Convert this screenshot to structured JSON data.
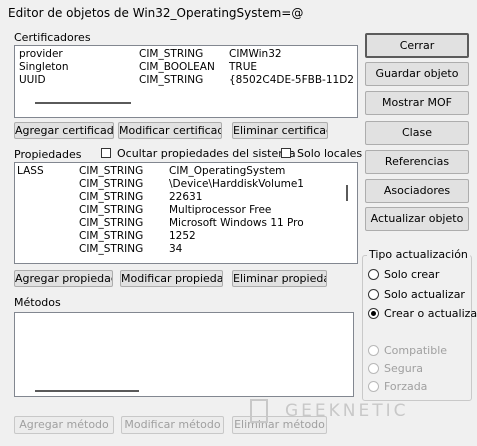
{
  "window": {
    "title": "Editor de objetos de Win32_OperatingSystem=@"
  },
  "qualifiers": {
    "label": "Certificadores",
    "rows": [
      {
        "name": "provider",
        "type": "CIM_STRING",
        "value": "CIMWin32"
      },
      {
        "name": "Singleton",
        "type": "CIM_BOOLEAN",
        "value": "TRUE"
      },
      {
        "name": "UUID",
        "type": "CIM_STRING",
        "value": "{8502C4DE-5FBB-11D2"
      }
    ],
    "buttons": {
      "add": "Agregar certificador",
      "edit": "Modificar certificador",
      "delete": "Eliminar certificador"
    }
  },
  "properties": {
    "label": "Propiedades",
    "hide_system_label": "Ocultar propiedades del sistema",
    "local_only_label": "Solo locales",
    "rows": [
      {
        "name": "LASS",
        "type": "CIM_STRING",
        "value": "CIM_OperatingSystem"
      },
      {
        "name": "",
        "type": "CIM_STRING",
        "value": "\\Device\\HarddiskVolume1"
      },
      {
        "name": "",
        "type": "CIM_STRING",
        "value": "22631"
      },
      {
        "name": "",
        "type": "CIM_STRING",
        "value": "Multiprocessor Free"
      },
      {
        "name": "",
        "type": "CIM_STRING",
        "value": "Microsoft Windows 11 Pro"
      },
      {
        "name": "",
        "type": "CIM_STRING",
        "value": "1252"
      },
      {
        "name": "",
        "type": "CIM_STRING",
        "value": "34"
      }
    ],
    "buttons": {
      "add": "Agregar propiedad",
      "edit": "Modificar propiedad",
      "delete": "Eliminar propiedad"
    }
  },
  "methods": {
    "label": "Métodos",
    "buttons": {
      "add": "Agregar método",
      "edit": "Modificar método",
      "delete": "Eliminar método"
    }
  },
  "side_buttons": {
    "close": "Cerrar",
    "save": "Guardar objeto",
    "show_mof": "Mostrar MOF",
    "class": "Clase",
    "references": "Referencias",
    "associators": "Asociadores",
    "refresh": "Actualizar objeto"
  },
  "update_type": {
    "title": "Tipo actualización",
    "options": [
      "Solo crear",
      "Solo actualizar",
      "Crear o actualizar"
    ],
    "selected": "Crear o actualizar",
    "disabled_options": [
      "Compatible",
      "Segura",
      "Forzada"
    ]
  },
  "watermark": {
    "text": "GEEKNETIC"
  }
}
